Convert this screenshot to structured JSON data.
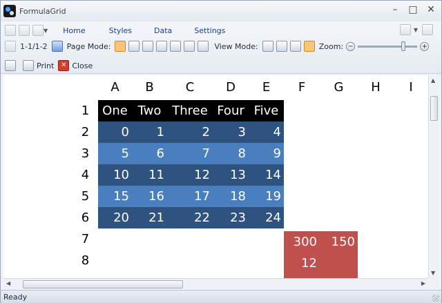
{
  "window": {
    "title": "FormulaGrid"
  },
  "window_buttons": {
    "minimize": "–",
    "maximize": "□",
    "close": "✕"
  },
  "menu": [
    "Home",
    "Styles",
    "Data",
    "Settings"
  ],
  "toolbar": {
    "page_range": "1-1/1-2",
    "page_mode_label": "Page Mode:",
    "view_mode_label": "View Mode:",
    "zoom_label": "Zoom:",
    "zoom_minus": "−",
    "zoom_plus": "+",
    "zoom_level": 0.78,
    "print_label": "Print",
    "close_label": "Close",
    "close_icon_glyph": "✕"
  },
  "sheet": {
    "columns": [
      "A",
      "B",
      "C",
      "D",
      "E",
      "F",
      "G",
      "H",
      "I"
    ],
    "rows": [
      "1",
      "2",
      "3",
      "4",
      "5",
      "6",
      "7",
      "8"
    ],
    "header_cells": [
      "One",
      "Two",
      "Three",
      "Four",
      "Five"
    ],
    "data_rows": [
      [
        "0",
        "1",
        "2",
        "3",
        "4"
      ],
      [
        "5",
        "6",
        "7",
        "8",
        "9"
      ],
      [
        "10",
        "11",
        "12",
        "13",
        "14"
      ],
      [
        "15",
        "16",
        "17",
        "18",
        "19"
      ],
      [
        "20",
        "21",
        "22",
        "23",
        "24"
      ]
    ],
    "red_cells": {
      "F7": "300",
      "G7": "150",
      "F8": "12"
    }
  },
  "colors": {
    "header_fill": "#000000",
    "dark_row": "#2f5381",
    "light_row": "#4a7fbf",
    "red_fill": "#c0504d"
  },
  "status": {
    "text": "Ready"
  }
}
